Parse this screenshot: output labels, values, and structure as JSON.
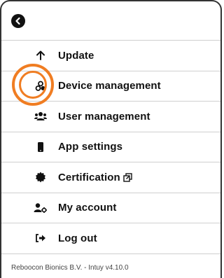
{
  "menu": {
    "items": [
      {
        "label": "Update",
        "icon": "arrow-up-icon"
      },
      {
        "label": "Device management",
        "icon": "devices-icon"
      },
      {
        "label": "User management",
        "icon": "users-icon"
      },
      {
        "label": "App settings",
        "icon": "phone-icon"
      },
      {
        "label": "Certification",
        "icon": "certificate-icon"
      },
      {
        "label": "My account",
        "icon": "user-settings-icon"
      },
      {
        "label": "Log out",
        "icon": "logout-icon"
      }
    ]
  },
  "footer": {
    "text": "Reboocon Bionics B.V. - Intuy v4.10.0"
  },
  "colors": {
    "highlight": "#f07d22",
    "text": "#111111",
    "divider": "#cfcfcf"
  }
}
